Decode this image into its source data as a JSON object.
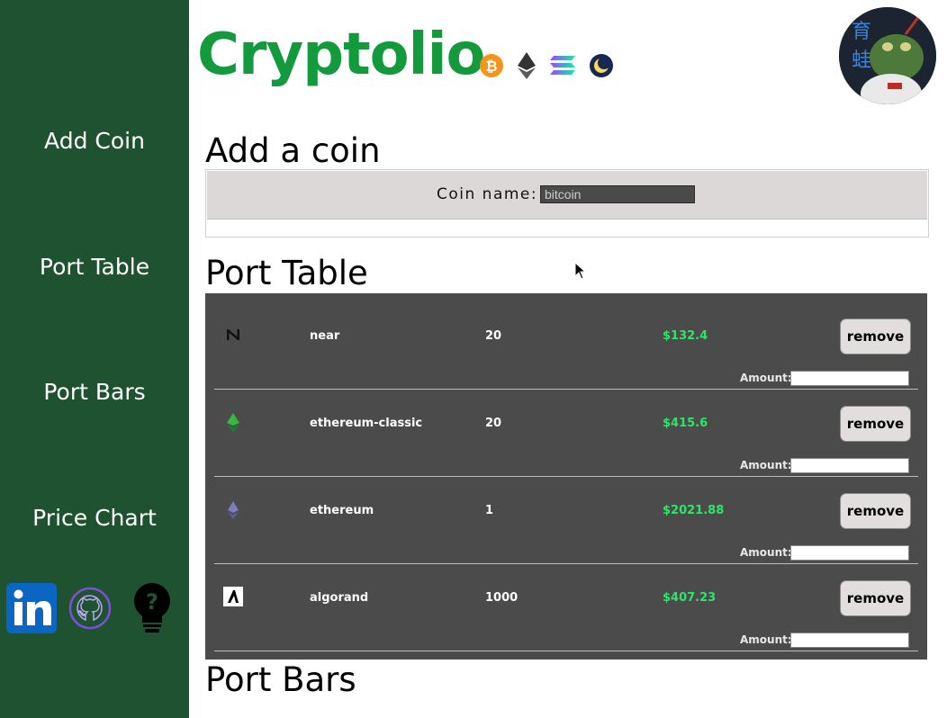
{
  "sidebar": {
    "items": [
      {
        "label": "Add Coin"
      },
      {
        "label": "Port Table"
      },
      {
        "label": "Port Bars"
      },
      {
        "label": "Price Chart"
      }
    ],
    "social": [
      "linkedin-icon",
      "github-icon",
      "help-icon"
    ]
  },
  "header": {
    "title": "Cryptolio",
    "coin_icons": [
      "bitcoin-icon",
      "ethereum-icon",
      "solana-icon",
      "terra-luna-icon"
    ]
  },
  "add_coin": {
    "heading": "Add a coin",
    "label": "Coin name:",
    "input_value": "bitcoin"
  },
  "port_table": {
    "heading": "Port Table",
    "rows": [
      {
        "name": "near",
        "qty": "20",
        "value": "$132.4",
        "remove_label": "remove",
        "amount_label": "Amount:",
        "icon": "near-icon"
      },
      {
        "name": "ethereum-classic",
        "qty": "20",
        "value": "$415.6",
        "remove_label": "remove",
        "amount_label": "Amount:",
        "icon": "ethereum-classic-icon"
      },
      {
        "name": "ethereum",
        "qty": "1",
        "value": "$2021.88",
        "remove_label": "remove",
        "amount_label": "Amount:",
        "icon": "ethereum-icon"
      },
      {
        "name": "algorand",
        "qty": "1000",
        "value": "$407.23",
        "remove_label": "remove",
        "amount_label": "Amount:",
        "icon": "algorand-icon"
      }
    ]
  },
  "port_bars": {
    "heading": "Port Bars"
  },
  "colors": {
    "sidebar_bg": "#1f5230",
    "brand_green": "#129a3c",
    "table_bg": "#4b4b4b",
    "price_green": "#2ee56a"
  }
}
